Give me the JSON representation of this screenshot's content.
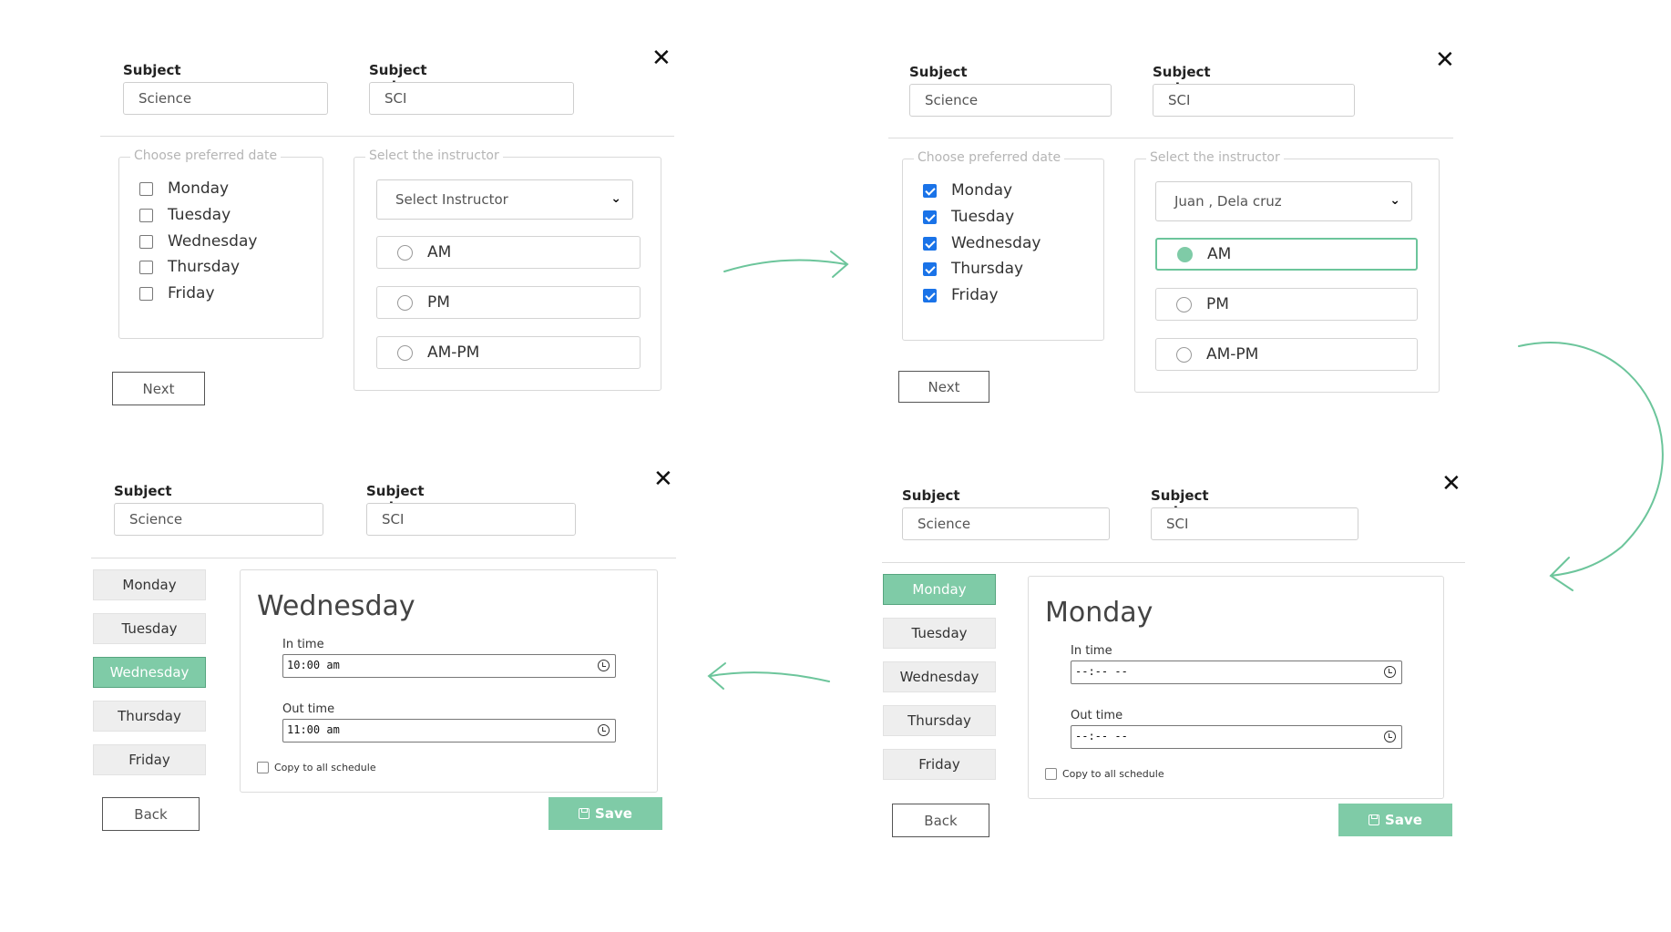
{
  "common": {
    "subject_label": "Subject",
    "subject_value": "Science",
    "code_label": "Subject code",
    "code_value": "SCI",
    "close_glyph": "✕"
  },
  "step1": {
    "date_legend": "Choose preferred date",
    "instructor_legend": "Select the instructor",
    "days": [
      {
        "label": "Monday",
        "checked": false
      },
      {
        "label": "Tuesday",
        "checked": false
      },
      {
        "label": "Wednesday",
        "checked": false
      },
      {
        "label": "Thursday",
        "checked": false
      },
      {
        "label": "Friday",
        "checked": false
      }
    ],
    "instructor_select": "Select Instructor",
    "options": [
      {
        "label": "AM",
        "selected": false
      },
      {
        "label": "PM",
        "selected": false
      },
      {
        "label": "AM-PM",
        "selected": false
      }
    ],
    "next_label": "Next"
  },
  "step2": {
    "date_legend": "Choose preferred date",
    "instructor_legend": "Select the instructor",
    "days": [
      {
        "label": "Monday",
        "checked": true
      },
      {
        "label": "Tuesday",
        "checked": true
      },
      {
        "label": "Wednesday",
        "checked": true
      },
      {
        "label": "Thursday",
        "checked": true
      },
      {
        "label": "Friday",
        "checked": true
      }
    ],
    "instructor_select": "Juan , Dela cruz",
    "options": [
      {
        "label": "AM",
        "selected": true
      },
      {
        "label": "PM",
        "selected": false
      },
      {
        "label": "AM-PM",
        "selected": false
      }
    ],
    "next_label": "Next"
  },
  "step3": {
    "day_tabs": [
      "Monday",
      "Tuesday",
      "Wednesday",
      "Thursday",
      "Friday"
    ],
    "active_day": "Wednesday",
    "card_title": "Wednesday",
    "in_label": "In time",
    "in_value": "10:00 am",
    "out_label": "Out time",
    "out_value": "11:00 am",
    "copy_label": "Copy to all schedule",
    "back_label": "Back",
    "save_label": "Save"
  },
  "step4": {
    "day_tabs": [
      "Monday",
      "Tuesday",
      "Wednesday",
      "Thursday",
      "Friday"
    ],
    "active_day": "Monday",
    "card_title": "Monday",
    "in_label": "In time",
    "in_value": "--:-- --",
    "out_label": "Out time",
    "out_value": "--:-- --",
    "copy_label": "Copy to all schedule",
    "back_label": "Back",
    "save_label": "Save"
  },
  "colors": {
    "accent_green": "#7fcba7",
    "checkbox_blue": "#1a73e8"
  }
}
